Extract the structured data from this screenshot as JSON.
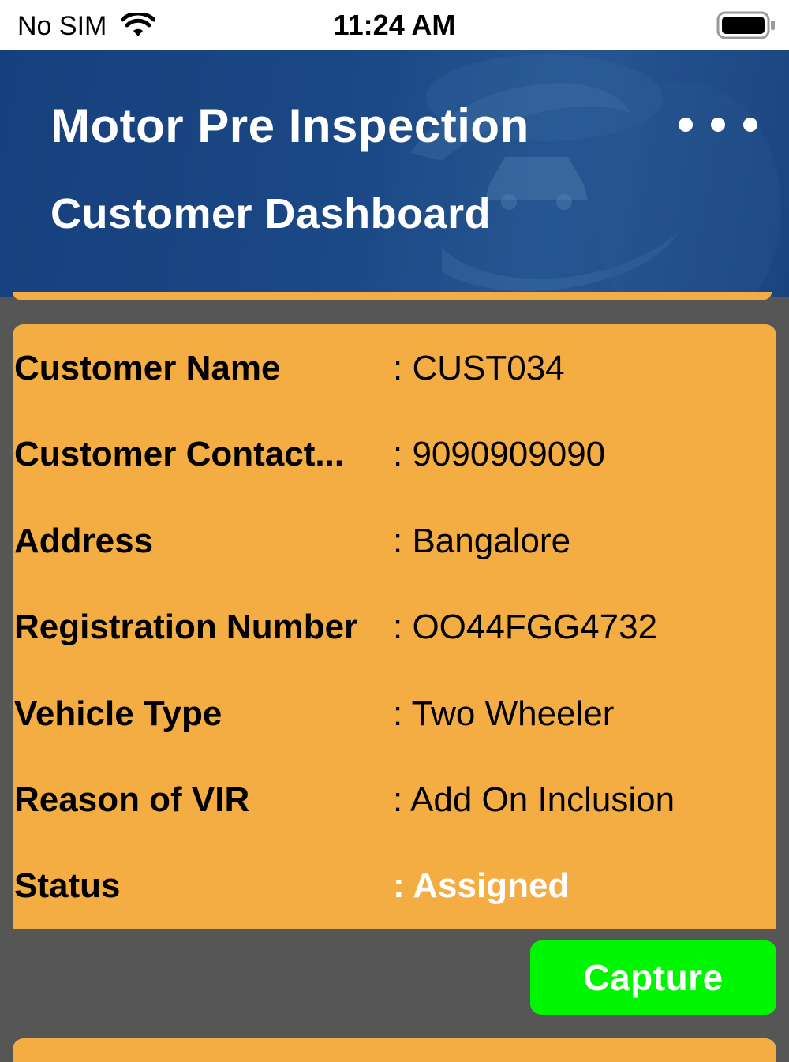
{
  "status_bar": {
    "carrier": "No SIM",
    "time": "11:24 AM",
    "wifi_icon": "wifi-icon",
    "battery_icon": "battery-icon"
  },
  "header": {
    "app_title": "Motor Pre Inspection",
    "page_title": "Customer Dashboard",
    "menu_icon": "more-horizontal-icon"
  },
  "customer": {
    "rows": [
      {
        "label": "Customer Name",
        "value": ": CUST034"
      },
      {
        "label": "Customer Contact...",
        "value": ": 9090909090"
      },
      {
        "label": "Address",
        "value": ": Bangalore"
      },
      {
        "label": "Registration Number",
        "value": ": OO44FGG4732"
      },
      {
        "label": "Vehicle Type",
        "value": ": Two Wheeler"
      },
      {
        "label": "Reason of VIR",
        "value": ": Add On Inclusion"
      },
      {
        "label": "Status",
        "value": ": Assigned"
      }
    ]
  },
  "actions": {
    "capture_label": "Capture"
  },
  "colors": {
    "header_blue": "#1d4a86",
    "card_orange": "#f4ad42",
    "capture_green": "#00f500",
    "background_gray": "#565656"
  }
}
